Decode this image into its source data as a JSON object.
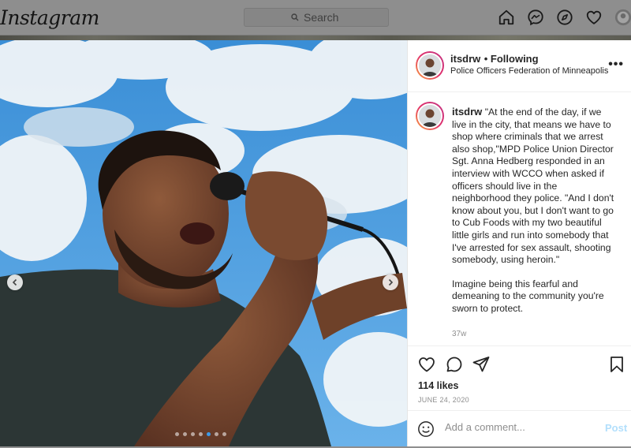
{
  "app": {
    "logo_text": "Instagram"
  },
  "search": {
    "placeholder": "Search"
  },
  "nav": {
    "icons": [
      "home-icon",
      "messenger-icon",
      "explore-icon",
      "heart-icon",
      "profile-avatar"
    ]
  },
  "post": {
    "username": "itsdrw",
    "follow_status": "• Following",
    "location": "Police Officers Federation of Minneapolis",
    "caption_paragraphs": [
      "\"At the end of the day, if we live in the city, that means we have to shop where criminals that we arrest also shop,\"MPD Police Union Director Sgt. Anna Hedberg responded in an interview with WCCO when asked if officers should live in the neighborhood they police. \"And I don't know about you, but I don't want to go to Cub Foods with my two beautiful little girls and run into somebody that I've arrested for sex assault, shooting somebody, using heroin.\"",
      "Imagine being this fearful and demeaning to the community you're sworn to protect."
    ],
    "age": "37w",
    "likes": "114 likes",
    "date": "JUNE 24, 2020",
    "more_glyph": "•••",
    "carousel": {
      "count": 7,
      "active_index": 4
    }
  },
  "comment": {
    "placeholder": "Add a comment...",
    "post_label": "Post"
  },
  "colors": {
    "accent": "#3d9be9",
    "post_disabled": "#b2dffc",
    "overlay": "#8e8e8e"
  }
}
